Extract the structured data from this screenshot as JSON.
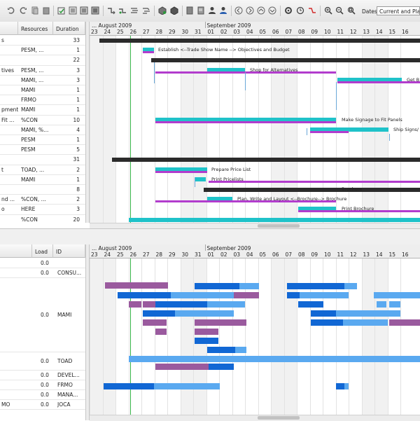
{
  "toolbar": {
    "dates_label": "Dates",
    "dates_value": "Current and Pla",
    "buttons": [
      "undo-icon",
      "redo-icon",
      "cut-icon",
      "paste-icon",
      "new-task-icon",
      "indent-icon",
      "outdent-icon",
      "link-tasks-icon",
      "unlink-icon",
      "split-icon",
      "move-up-icon",
      "move-down-icon",
      "resources-icon",
      "assign-icon",
      "notes-icon",
      "person-icon",
      "add-person-icon",
      "nav-left-icon",
      "nav-right-icon",
      "nav-up-icon",
      "nav-down-icon",
      "settings-icon",
      "history-icon",
      "critical-path-icon",
      "zoom-in-icon",
      "zoom-out-icon",
      "zoom-fit-icon"
    ]
  },
  "task_table": {
    "columns": [
      "",
      "Resources",
      "Duration"
    ],
    "rows": [
      {
        "name": "s",
        "resources": "",
        "duration": "33"
      },
      {
        "name": "",
        "resources": "PESM, ...",
        "duration": "1"
      },
      {
        "name": "",
        "resources": "",
        "duration": "22"
      },
      {
        "name": "tives",
        "resources": "PESM, ...",
        "duration": "3"
      },
      {
        "name": "",
        "resources": "MAMI, ...",
        "duration": "3"
      },
      {
        "name": "",
        "resources": "MAMI",
        "duration": "1"
      },
      {
        "name": "",
        "resources": "FRMO",
        "duration": "1"
      },
      {
        "name": "pment",
        "resources": "MAMI",
        "duration": "1"
      },
      {
        "name": "Fit ...",
        "resources": "%CON",
        "duration": "10"
      },
      {
        "name": "",
        "resources": "MAMI, %...",
        "duration": "4"
      },
      {
        "name": "",
        "resources": "PESM",
        "duration": "1"
      },
      {
        "name": "",
        "resources": "PESM",
        "duration": "5"
      },
      {
        "name": "",
        "resources": "",
        "duration": "31"
      },
      {
        "name": "t",
        "resources": "TOAD, ...",
        "duration": "2"
      },
      {
        "name": "",
        "resources": "MAMI",
        "duration": "1"
      },
      {
        "name": "",
        "resources": "",
        "duration": "8"
      },
      {
        "name": "nd ...",
        "resources": "%CON, ...",
        "duration": "2"
      },
      {
        "name": "o",
        "resources": "HERE",
        "duration": "3"
      },
      {
        "name": "",
        "resources": "%CON",
        "duration": "20"
      }
    ]
  },
  "timeline": {
    "months": [
      "... August 2009",
      "September 2009"
    ],
    "days": [
      "23",
      "24",
      "25",
      "26",
      "27",
      "28",
      "29",
      "30",
      "31",
      "01",
      "02",
      "03",
      "04",
      "05",
      "06",
      "07",
      "08",
      "09",
      "10",
      "11",
      "12",
      "13",
      "14",
      "15",
      "16"
    ],
    "task_labels": [
      "Establish <--Trade Show Name --> Objectives and Budget",
      "Shop for Alternatives",
      "Get B",
      "Make Signage to Fit Panels",
      "Ship Signs/",
      "Brochure",
      "Prepare Price List",
      "Print Pricelists",
      "Brochure",
      "Plan, Write and Layout <--Brochure--> Brochure",
      "Print Brochure"
    ]
  },
  "resource_table": {
    "columns": [
      "",
      "Load",
      "ID"
    ],
    "rows": [
      {
        "name": "",
        "load": "0.0",
        "id": ""
      },
      {
        "name": "",
        "load": "0.0",
        "id": "CONSU..."
      },
      {
        "name": "",
        "load": "0.0",
        "id": "MAMI"
      },
      {
        "name": "",
        "load": "0.0",
        "id": "TOAD"
      },
      {
        "name": "",
        "load": "0.0",
        "id": "DEVEL..."
      },
      {
        "name": "",
        "load": "0.0",
        "id": "FRMO"
      },
      {
        "name": "",
        "load": "0.0",
        "id": "MANA..."
      },
      {
        "name": "MO",
        "load": "0.0",
        "id": "JOCA"
      }
    ]
  },
  "colors": {
    "summary": "#2b2b2b",
    "task": "#1fc2c9",
    "baseline": "#b23ccd",
    "today": "#39b54a",
    "load_dark": "#1167d4",
    "load_light": "#5aa9f0",
    "load_over": "#9a5a9e"
  }
}
